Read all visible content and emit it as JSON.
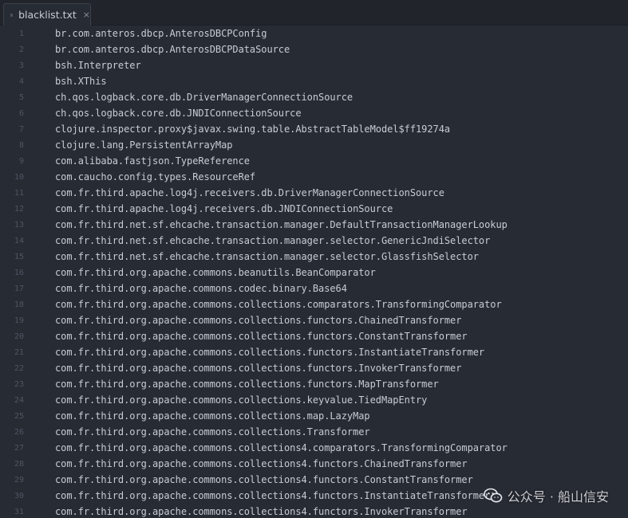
{
  "tab": {
    "filename": "blacklist.txt",
    "close_glyph": "×"
  },
  "watermark": {
    "text": "公众号 · 船山信安",
    "logo_icon": "wechat-icon"
  },
  "colors": {
    "background": "#272b33",
    "tabbar": "#21242b",
    "text": "#c8ccd4",
    "line_number": "#4f5663"
  },
  "lines": [
    {
      "num": "1",
      "text": "br.com.anteros.dbcp.AnterosDBCPConfig"
    },
    {
      "num": "2",
      "text": "br.com.anteros.dbcp.AnterosDBCPDataSource"
    },
    {
      "num": "3",
      "text": "bsh.Interpreter"
    },
    {
      "num": "4",
      "text": "bsh.XThis"
    },
    {
      "num": "5",
      "text": "ch.qos.logback.core.db.DriverManagerConnectionSource"
    },
    {
      "num": "6",
      "text": "ch.qos.logback.core.db.JNDIConnectionSource"
    },
    {
      "num": "7",
      "text": "clojure.inspector.proxy$javax.swing.table.AbstractTableModel$ff19274a"
    },
    {
      "num": "8",
      "text": "clojure.lang.PersistentArrayMap"
    },
    {
      "num": "9",
      "text": "com.alibaba.fastjson.TypeReference"
    },
    {
      "num": "10",
      "text": "com.caucho.config.types.ResourceRef"
    },
    {
      "num": "11",
      "text": "com.fr.third.apache.log4j.receivers.db.DriverManagerConnectionSource"
    },
    {
      "num": "12",
      "text": "com.fr.third.apache.log4j.receivers.db.JNDIConnectionSource"
    },
    {
      "num": "13",
      "text": "com.fr.third.net.sf.ehcache.transaction.manager.DefaultTransactionManagerLookup"
    },
    {
      "num": "14",
      "text": "com.fr.third.net.sf.ehcache.transaction.manager.selector.GenericJndiSelector"
    },
    {
      "num": "15",
      "text": "com.fr.third.net.sf.ehcache.transaction.manager.selector.GlassfishSelector"
    },
    {
      "num": "16",
      "text": "com.fr.third.org.apache.commons.beanutils.BeanComparator"
    },
    {
      "num": "17",
      "text": "com.fr.third.org.apache.commons.codec.binary.Base64"
    },
    {
      "num": "18",
      "text": "com.fr.third.org.apache.commons.collections.comparators.TransformingComparator"
    },
    {
      "num": "19",
      "text": "com.fr.third.org.apache.commons.collections.functors.ChainedTransformer"
    },
    {
      "num": "20",
      "text": "com.fr.third.org.apache.commons.collections.functors.ConstantTransformer"
    },
    {
      "num": "21",
      "text": "com.fr.third.org.apache.commons.collections.functors.InstantiateTransformer"
    },
    {
      "num": "22",
      "text": "com.fr.third.org.apache.commons.collections.functors.InvokerTransformer"
    },
    {
      "num": "23",
      "text": "com.fr.third.org.apache.commons.collections.functors.MapTransformer"
    },
    {
      "num": "24",
      "text": "com.fr.third.org.apache.commons.collections.keyvalue.TiedMapEntry"
    },
    {
      "num": "25",
      "text": "com.fr.third.org.apache.commons.collections.map.LazyMap"
    },
    {
      "num": "26",
      "text": "com.fr.third.org.apache.commons.collections.Transformer"
    },
    {
      "num": "27",
      "text": "com.fr.third.org.apache.commons.collections4.comparators.TransformingComparator"
    },
    {
      "num": "28",
      "text": "com.fr.third.org.apache.commons.collections4.functors.ChainedTransformer"
    },
    {
      "num": "29",
      "text": "com.fr.third.org.apache.commons.collections4.functors.ConstantTransformer"
    },
    {
      "num": "30",
      "text": "com.fr.third.org.apache.commons.collections4.functors.InstantiateTransformer"
    },
    {
      "num": "31",
      "text": "com.fr.third.org.apache.commons.collections4.functors.InvokerTransformer"
    }
  ]
}
